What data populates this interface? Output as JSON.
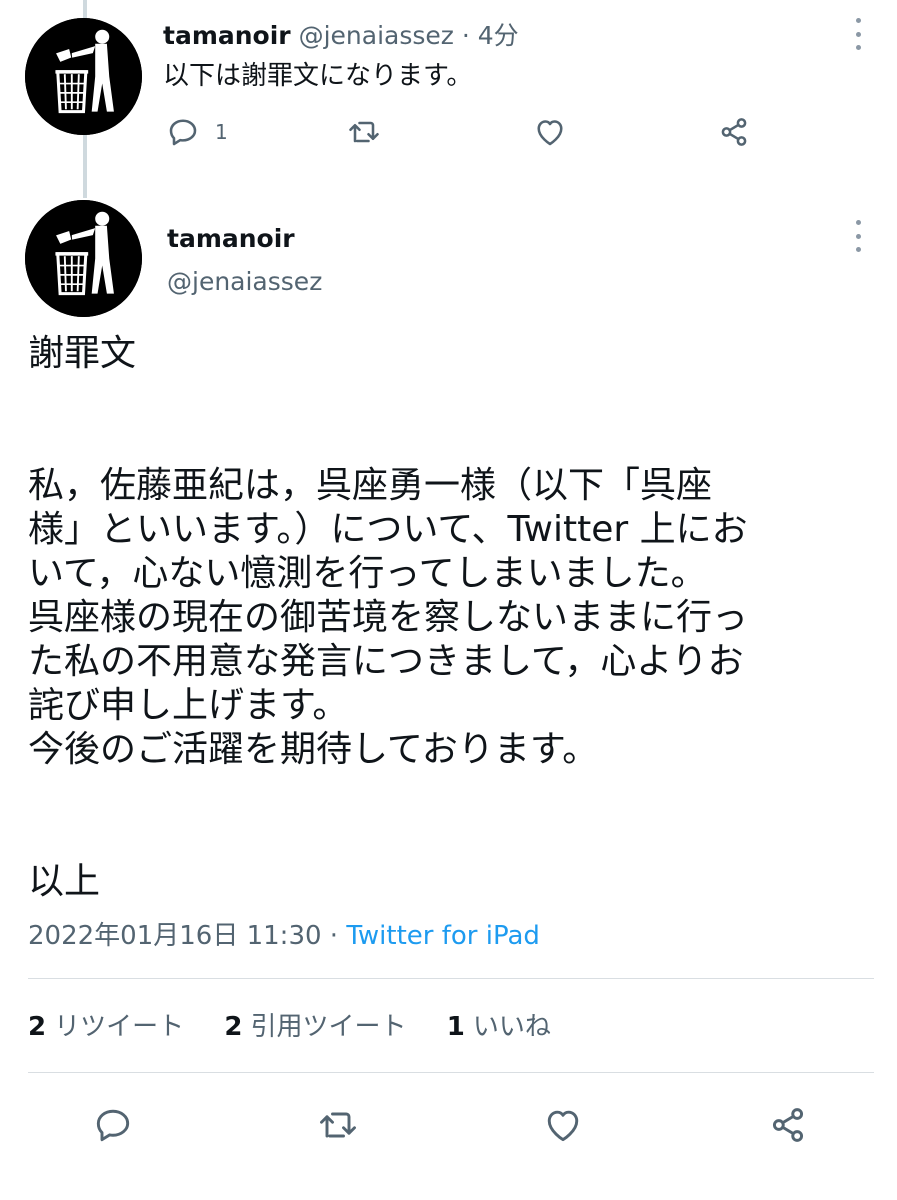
{
  "reply_tweet": {
    "display_name": "tamanoir",
    "handle": "@jenaiassez",
    "separator": "·",
    "time": "4分",
    "text": "以下は謝罪文になります。",
    "reply_count": "1"
  },
  "main_tweet": {
    "display_name": "tamanoir",
    "handle": "@jenaiassez",
    "body_title": "謝罪文",
    "body_lines": [
      "私，佐藤亜紀は，呉座勇一様（以下「呉座",
      "様」といいます。）について、Twitter 上にお",
      "いて，心ない憶測を行ってしまいました。",
      "呉座様の現在の御苦境を察しないままに行っ",
      "た私の不用意な発言につきまして，心よりお",
      "詫び申し上げます。",
      "今後のご活躍を期待しております。"
    ],
    "closing": "以上",
    "timestamp": "2022年01月16日 11:30",
    "meta_separator": "·",
    "source": "Twitter for iPad",
    "stats": {
      "retweets_count": "2",
      "retweets_label": "リツイート",
      "quotes_count": "2",
      "quotes_label": "引用ツイート",
      "likes_count": "1",
      "likes_label": "いいね"
    }
  },
  "icons": {
    "reply": "reply-icon",
    "retweet": "retweet-icon",
    "like": "heart-icon",
    "share": "share-icon",
    "more": "more-vertical-icon",
    "avatar": "trash-bin-person-logo"
  },
  "colors": {
    "text_primary": "#0f1419",
    "text_secondary": "#536471",
    "link": "#1d9bf0",
    "icon": "#536471",
    "divider": "#d9dee2",
    "thread_line": "#cfd9de"
  }
}
